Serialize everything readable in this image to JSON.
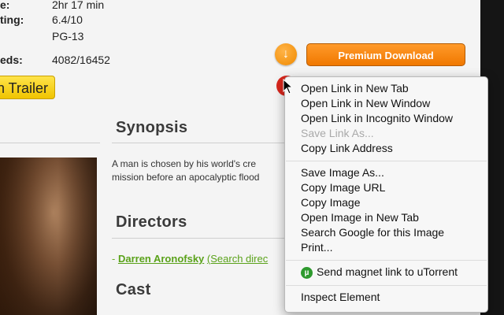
{
  "meta": {
    "runtime_label": "e:",
    "runtime_value": "2hr 17 min",
    "rating_label": "ting:",
    "rating_value": "6.4/10",
    "mpaa_value": "PG-13",
    "seeds_label": "eds:",
    "seeds_value": "4082/16452"
  },
  "buttons": {
    "trailer_label": "n Trailer",
    "premium_download_label": "Premium Download",
    "download_icon": "download-arrow-icon"
  },
  "synopsis": {
    "heading": "Synopsis",
    "line1": "A man is chosen by his world's cre",
    "line2": "mission before an apocalyptic flood"
  },
  "directors": {
    "heading": "Directors",
    "dash": "- ",
    "name": "Darren Aronofsky",
    "search_text": "(Search direc"
  },
  "cast": {
    "heading": "Cast"
  },
  "context_menu": {
    "open_new_tab": "Open Link in New Tab",
    "open_new_window": "Open Link in New Window",
    "open_incognito": "Open Link in Incognito Window",
    "save_link_as": "Save Link As...",
    "copy_link_address": "Copy Link Address",
    "save_image_as": "Save Image As...",
    "copy_image_url": "Copy Image URL",
    "copy_image": "Copy Image",
    "open_image_new_tab": "Open Image in New Tab",
    "search_google_image": "Search Google for this Image",
    "print": "Print...",
    "utorrent_icon_glyph": "µ",
    "send_magnet": "Send magnet link to uTorrent",
    "inspect_element": "Inspect Element"
  },
  "colors": {
    "premium_orange": "#f07800",
    "green_link": "#5aa21a",
    "trailer_yellow": "#f0c400"
  }
}
